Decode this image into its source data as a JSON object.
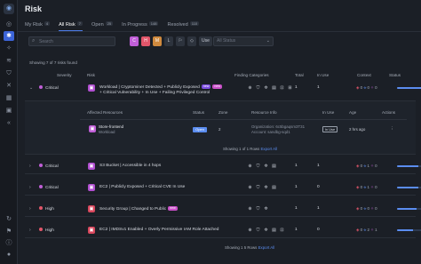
{
  "page": {
    "title": "Risk"
  },
  "tabs": [
    {
      "label": "My Risk",
      "count": "4"
    },
    {
      "label": "All Risk",
      "count": "7"
    },
    {
      "label": "Open",
      "count": "25"
    },
    {
      "label": "In Progress",
      "count": "148"
    },
    {
      "label": "Resolved",
      "count": "110"
    }
  ],
  "filters": {
    "search_placeholder": "Search",
    "severity_buttons": [
      "C",
      "H",
      "M",
      "L"
    ],
    "in_use_label": "Use",
    "status_placeholder": "All Status"
  },
  "summary": "Showing 7 of 7 risks found",
  "columns": {
    "severity": "Severity",
    "risk": "Risk",
    "finding_categories": "Finding Categories",
    "total": "Total",
    "in_use": "In Use",
    "context": "Context",
    "status": "Status"
  },
  "rows": [
    {
      "severity": "Critical",
      "severity_color": "#c15fd8",
      "title_line1": "Workload | Cryptominer Detected + Publicly Exposed",
      "title_line2": "+ Critical Vulnerability + In Use + Failing Privileged Control",
      "badges": [
        {
          "label": "new",
          "color": "#7c4de0"
        },
        {
          "label": "new",
          "color": "#c94fc8"
        }
      ],
      "total": "1",
      "in_use": "1",
      "context": {
        "a": "0",
        "b": "0",
        "c": "0"
      },
      "status_fill": 0.9
    },
    {
      "severity": "Critical",
      "severity_color": "#c15fd8",
      "title_line1": "S3 Bucket | Accessible in 4 hops",
      "badges": [],
      "total": "1",
      "in_use": "1",
      "context": {
        "a": "0",
        "b": "1",
        "c": "0"
      },
      "status_fill": 0.6
    },
    {
      "severity": "Critical",
      "severity_color": "#c15fd8",
      "title_line1": "EC2 | Publicly Exposed + Critical CVE In Use",
      "badges": [],
      "total": "1",
      "in_use": "0",
      "context": {
        "a": "0",
        "b": "1",
        "c": "0"
      },
      "status_fill": 0.6
    },
    {
      "severity": "High",
      "severity_color": "#e2566a",
      "title_line1": "Security Group | Changed to Public",
      "badges": [
        {
          "label": "new",
          "color": "#c94fc8"
        }
      ],
      "total": "1",
      "in_use": "1",
      "context": {
        "a": "0",
        "b": "0",
        "c": "0"
      },
      "status_fill": 0.55
    },
    {
      "severity": "High",
      "severity_color": "#e2566a",
      "title_line1": "EC2 | IMDSv1 Enabled + Overly Permissive IAM Role Attached",
      "badges": [],
      "total": "1",
      "in_use": "0",
      "context": {
        "a": "0",
        "b": "2",
        "c": "1"
      },
      "status_fill": 0.45
    }
  ],
  "detail": {
    "headers": {
      "affected": "Affected Resources",
      "status": "Status",
      "zone": "Zone",
      "resource_info": "Resource Info",
      "in_use": "In Use",
      "age": "Age",
      "actions": "Actions"
    },
    "resource_name": "Store-frontend",
    "resource_type": "Workload",
    "status": "Open",
    "zone": "2",
    "org": "Organization: 6c5bgaqsm3T31",
    "account": "Account: sandbg-sqd1",
    "in_use": "In Use",
    "age": "2 hrs ago",
    "showing": "Showing 1 of 1 Rows",
    "export": "Export All"
  },
  "footer": {
    "showing": "Showing 1 5 Rows",
    "export": "Export All"
  },
  "colors": {
    "accent": "#3c64d8",
    "bar": "#5b8df0",
    "critical": "#c15fd8",
    "high": "#e2566a"
  }
}
